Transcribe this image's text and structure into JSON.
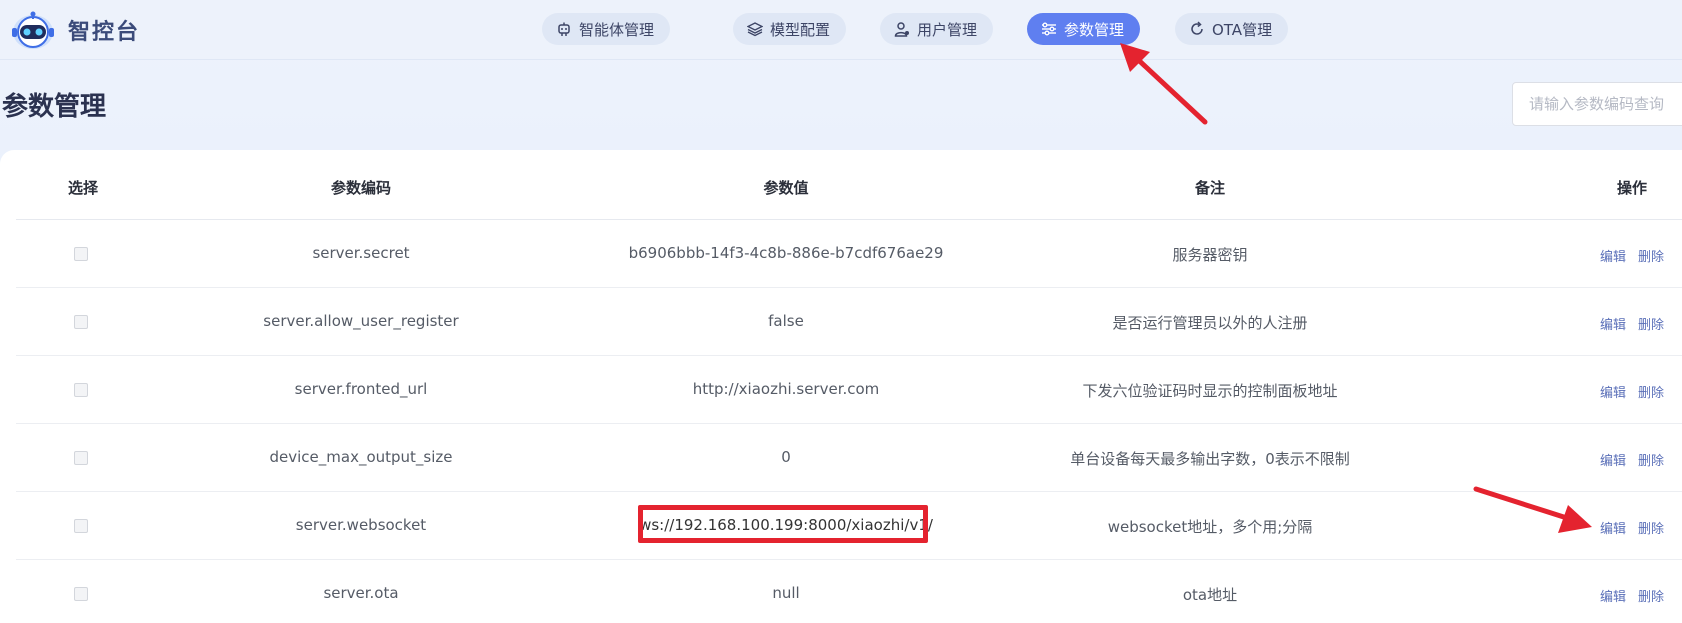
{
  "header": {
    "brand": "智控台",
    "nav": [
      {
        "label": "智能体管理",
        "icon": "robot-icon",
        "active": false
      },
      {
        "label": "模型配置",
        "icon": "layers-icon",
        "active": false
      },
      {
        "label": "用户管理",
        "icon": "user-icon",
        "active": false
      },
      {
        "label": "参数管理",
        "icon": "sliders-icon",
        "active": true
      },
      {
        "label": "OTA管理",
        "icon": "refresh-icon",
        "active": false
      }
    ]
  },
  "page": {
    "title": "参数管理",
    "search_placeholder": "请输入参数编码查询"
  },
  "table": {
    "columns": [
      "选择",
      "参数编码",
      "参数值",
      "备注",
      "操作"
    ],
    "rows": [
      {
        "code": "server.secret",
        "value": "b6906bbb-14f3-4c8b-886e-b7cdf676ae29",
        "remark": "服务器密钥"
      },
      {
        "code": "server.allow_user_register",
        "value": "false",
        "remark": "是否运行管理员以外的人注册"
      },
      {
        "code": "server.fronted_url",
        "value": "http://xiaozhi.server.com",
        "remark": "下发六位验证码时显示的控制面板地址"
      },
      {
        "code": "device_max_output_size",
        "value": "0",
        "remark": "单台设备每天最多输出字数，0表示不限制"
      },
      {
        "code": "server.websocket",
        "value": "ws://192.168.100.199:8000/xiaozhi/v1/",
        "remark": "websocket地址，多个用;分隔"
      },
      {
        "code": "server.ota",
        "value": "null",
        "remark": "ota地址"
      }
    ],
    "actions": {
      "edit": "编辑",
      "delete": "删除"
    }
  },
  "annotation": {
    "highlight_color": "#e4232f"
  },
  "colors": {
    "accent": "#5f7ff0",
    "link": "#5a6fb8"
  }
}
